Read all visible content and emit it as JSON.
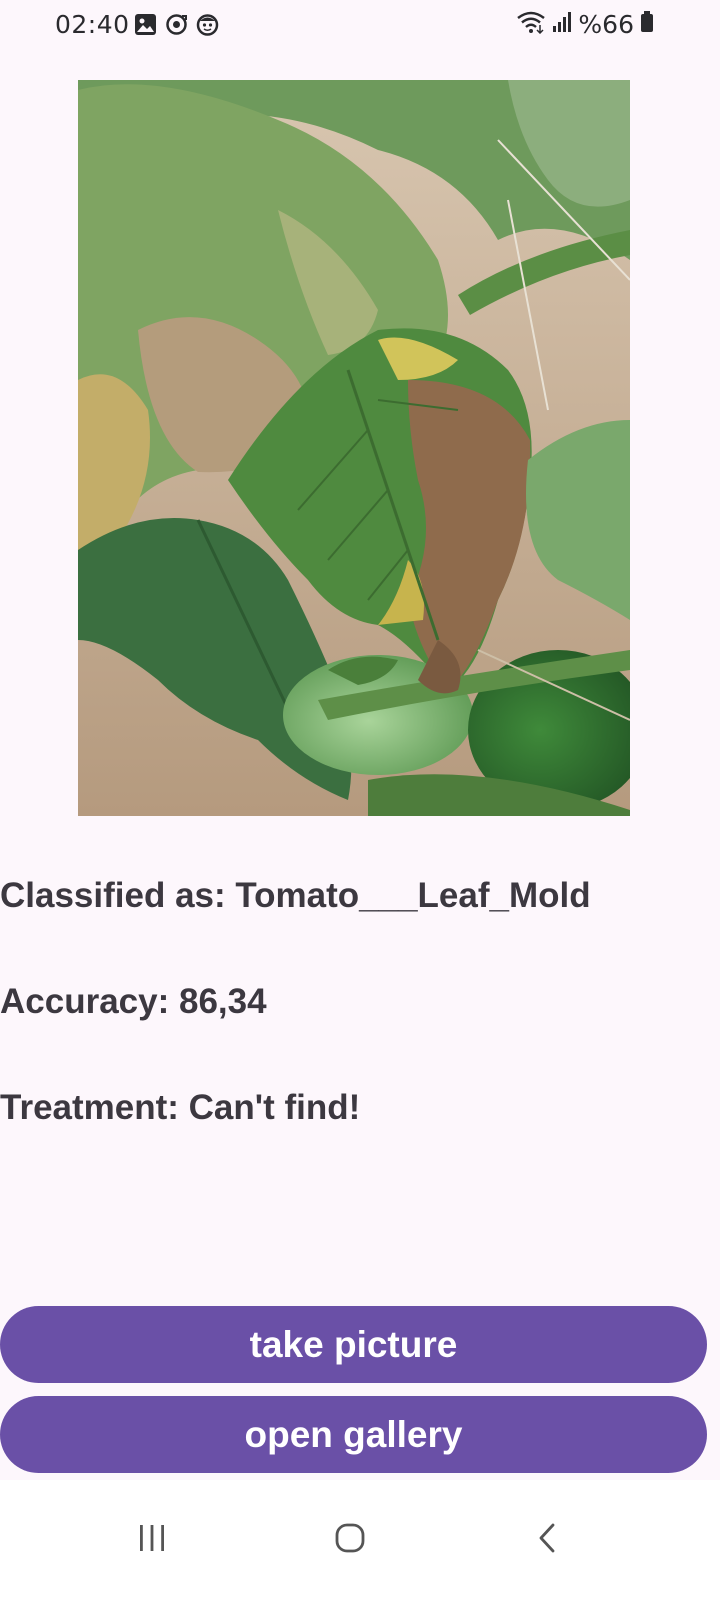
{
  "status_bar": {
    "time": "02:40",
    "left_icons": [
      "gallery-icon",
      "sync-icon",
      "face-icon"
    ],
    "right_icons": [
      "wifi-icon",
      "signal-icon",
      "battery-icon"
    ],
    "battery": "%66"
  },
  "photo": {
    "subject": "tomato plant leaves with leaf mold"
  },
  "result": {
    "classified": "Classified as: Tomato___Leaf_Mold",
    "accuracy": "Accuracy: 86,34",
    "treatment": "Treatment: Can't find!"
  },
  "buttons": {
    "take_picture": "take picture",
    "open_gallery": "open gallery"
  },
  "navigation": {
    "icons": [
      "recent-apps-icon",
      "home-icon",
      "back-icon"
    ]
  },
  "colors": {
    "background": "#fdf7fc",
    "button": "#6a50a7",
    "text": "#3c3840"
  }
}
